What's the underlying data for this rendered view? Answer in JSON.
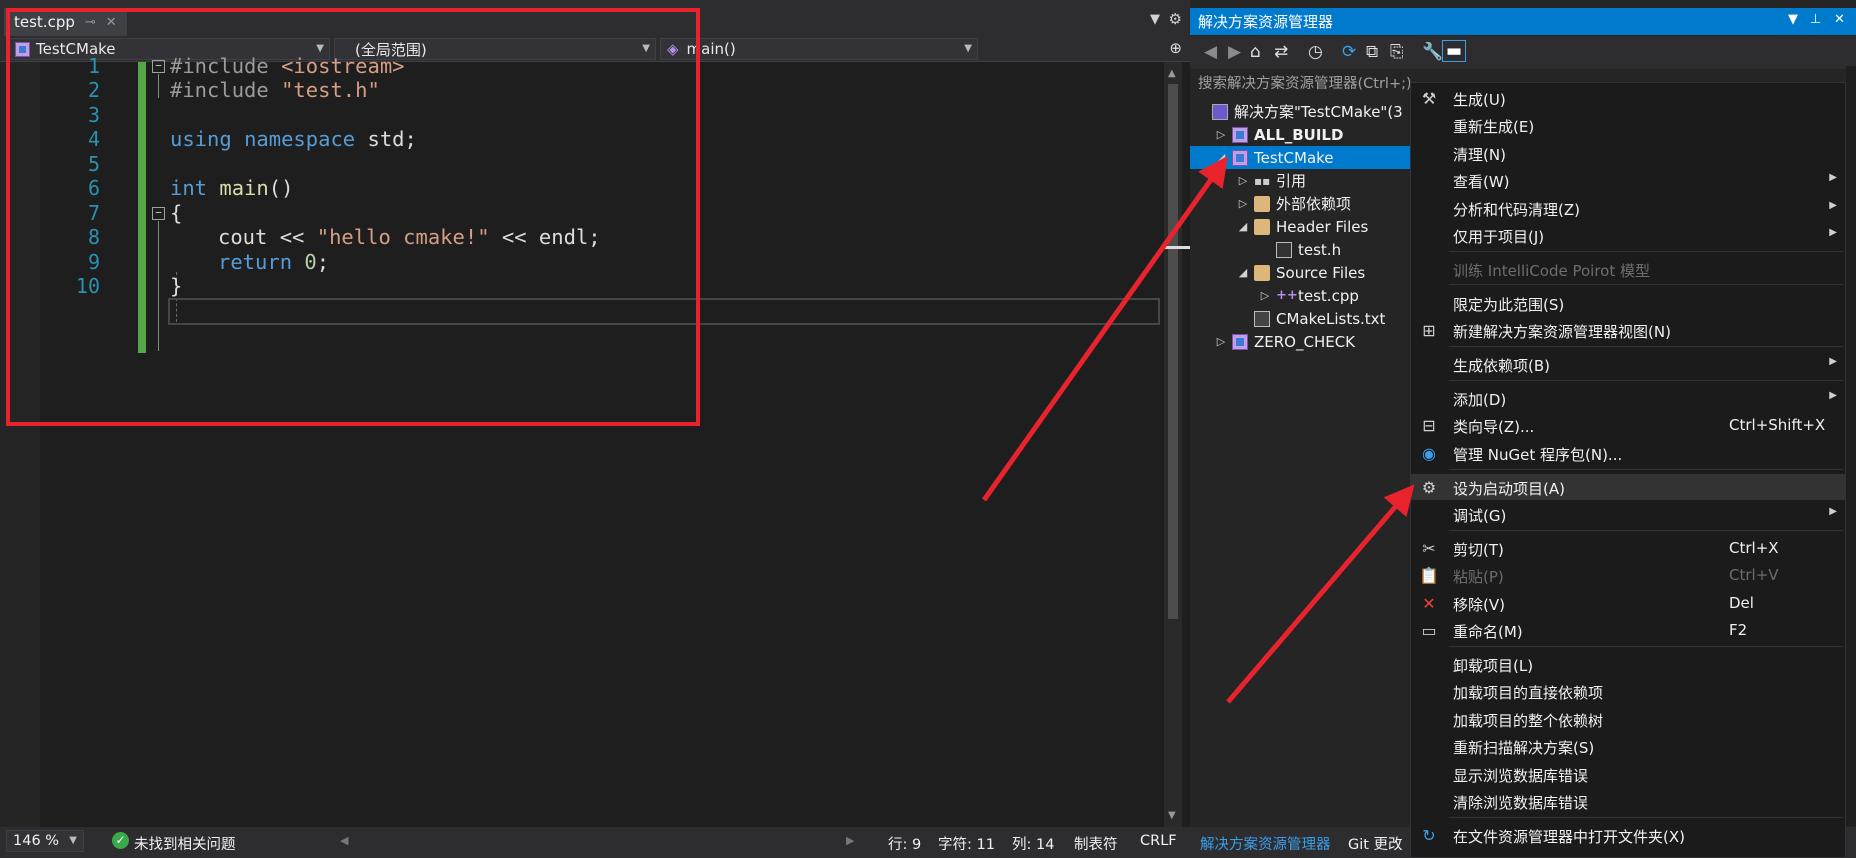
{
  "editor": {
    "tab_title": "test.cpp",
    "nav": {
      "project": "TestCMake",
      "scope": "(全局范围)",
      "member": "main()"
    },
    "line_numbers": [
      "1",
      "2",
      "3",
      "4",
      "5",
      "6",
      "7",
      "8",
      "9",
      "10"
    ],
    "code": {
      "l1_pp": "#include",
      "l1_inc": "<iostream>",
      "l2_pp": "#include",
      "l2_inc": "\"test.h\"",
      "l4_kw1": "using",
      "l4_kw2": "namespace",
      "l4_rest": "std;",
      "l6_kw": "int",
      "l6_fn": "main",
      "l6_rest": "()",
      "l7": "{",
      "l8_a": "cout",
      "l8_op": "<<",
      "l8_str": "\"hello cmake!\"",
      "l8_op2": "<<",
      "l8_b": "endl;",
      "l9_kw": "return",
      "l9_num": "0",
      "l9_rest": ";",
      "l10": "}"
    },
    "status": {
      "zoom": "146 %",
      "issues": "未找到相关问题",
      "line": "行: 9",
      "char": "字符: 11",
      "col": "列: 14",
      "tabs": "制表符",
      "eol": "CRLF"
    }
  },
  "solution_explorer": {
    "title": "解决方案资源管理器",
    "search_placeholder": "搜索解决方案资源管理器(Ctrl+;)",
    "tree": [
      {
        "label": "解决方案\"TestCMake\"(3"
      },
      {
        "label": "ALL_BUILD"
      },
      {
        "label": "TestCMake"
      },
      {
        "label": "引用"
      },
      {
        "label": "外部依赖项"
      },
      {
        "label": "Header Files"
      },
      {
        "label": "test.h"
      },
      {
        "label": "Source Files"
      },
      {
        "label": "test.cpp"
      },
      {
        "label": "CMakeLists.txt"
      },
      {
        "label": "ZERO_CHECK"
      }
    ],
    "bottom_tabs": [
      "解决方案资源管理器",
      "Git 更改"
    ]
  },
  "context_menu": {
    "items": [
      {
        "label": "生成(U)",
        "shortcut": ""
      },
      {
        "label": "重新生成(E)",
        "shortcut": ""
      },
      {
        "label": "清理(N)",
        "shortcut": ""
      },
      {
        "label": "查看(W)",
        "shortcut": ""
      },
      {
        "label": "分析和代码清理(Z)",
        "shortcut": ""
      },
      {
        "label": "仅用于项目(J)",
        "shortcut": ""
      },
      {
        "label": "训练 IntelliCode Poirot 模型",
        "shortcut": ""
      },
      {
        "label": "限定为此范围(S)",
        "shortcut": ""
      },
      {
        "label": "新建解决方案资源管理器视图(N)",
        "shortcut": ""
      },
      {
        "label": "生成依赖项(B)",
        "shortcut": ""
      },
      {
        "label": "添加(D)",
        "shortcut": ""
      },
      {
        "label": "类向导(Z)...",
        "shortcut": "Ctrl+Shift+X"
      },
      {
        "label": "管理 NuGet 程序包(N)...",
        "shortcut": ""
      },
      {
        "label": "设为启动项目(A)",
        "shortcut": ""
      },
      {
        "label": "调试(G)",
        "shortcut": ""
      },
      {
        "label": "剪切(T)",
        "shortcut": "Ctrl+X"
      },
      {
        "label": "粘贴(P)",
        "shortcut": "Ctrl+V"
      },
      {
        "label": "移除(V)",
        "shortcut": "Del"
      },
      {
        "label": "重命名(M)",
        "shortcut": "F2"
      },
      {
        "label": "卸载项目(L)",
        "shortcut": ""
      },
      {
        "label": "加载项目的直接依赖项",
        "shortcut": ""
      },
      {
        "label": "加载项目的整个依赖树",
        "shortcut": ""
      },
      {
        "label": "重新扫描解决方案(S)",
        "shortcut": ""
      },
      {
        "label": "显示浏览数据库错误",
        "shortcut": ""
      },
      {
        "label": "清除浏览数据库错误",
        "shortcut": ""
      },
      {
        "label": "在文件资源管理器中打开文件夹(X)",
        "shortcut": ""
      }
    ]
  },
  "colors": {
    "accent": "#007acc",
    "annotation_red": "#e8232d",
    "editor_bg": "#1e1e1e"
  }
}
